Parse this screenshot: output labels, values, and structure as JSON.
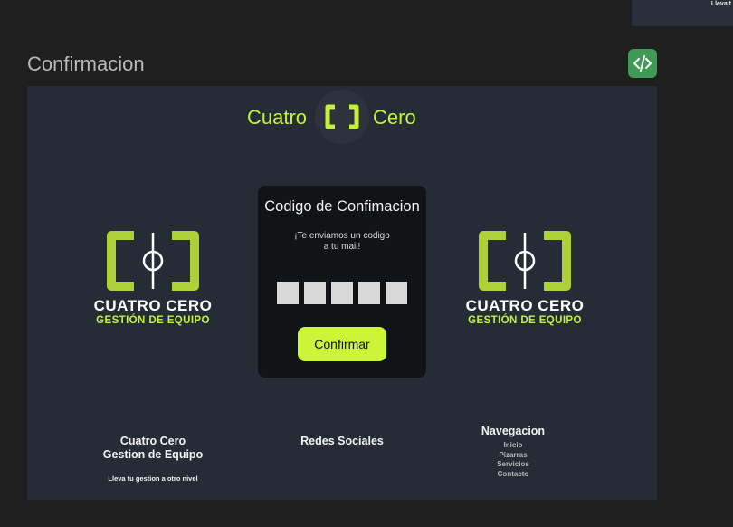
{
  "thumbnail": {
    "text": "Lleva t"
  },
  "frame": {
    "title": "Confirmacion"
  },
  "toolbar": {
    "code_icon": "code-icon",
    "accent": "#3f9a55"
  },
  "header": {
    "left_text": "Cuatro",
    "right_text": "Cero",
    "accent": "#c6f03a"
  },
  "brand_left": {
    "name": "CUATRO CERO",
    "sub": "GESTIÓN DE EQUIPO"
  },
  "brand_right": {
    "name": "CUATRO CERO",
    "sub": "GESTIÓN DE EQUIPO"
  },
  "card": {
    "title": "Codigo de Confimacion",
    "message_line1": "¡Te enviamos un codigo",
    "message_line2": "a tu mail!",
    "confirm_label": "Confirmar",
    "digit_values": [
      "",
      "",
      "",
      "",
      ""
    ]
  },
  "footer": {
    "col1": {
      "title_line1": "Cuatro Cero",
      "title_line2": "Gestion de Equipo",
      "tagline": "Lleva tu gestion a otro nivel"
    },
    "col2": {
      "title": "Redes Sociales"
    },
    "col3": {
      "title": "Navegacion",
      "links": [
        "Inicio",
        "Pizarras",
        "Servicios",
        "Contacto"
      ]
    }
  }
}
